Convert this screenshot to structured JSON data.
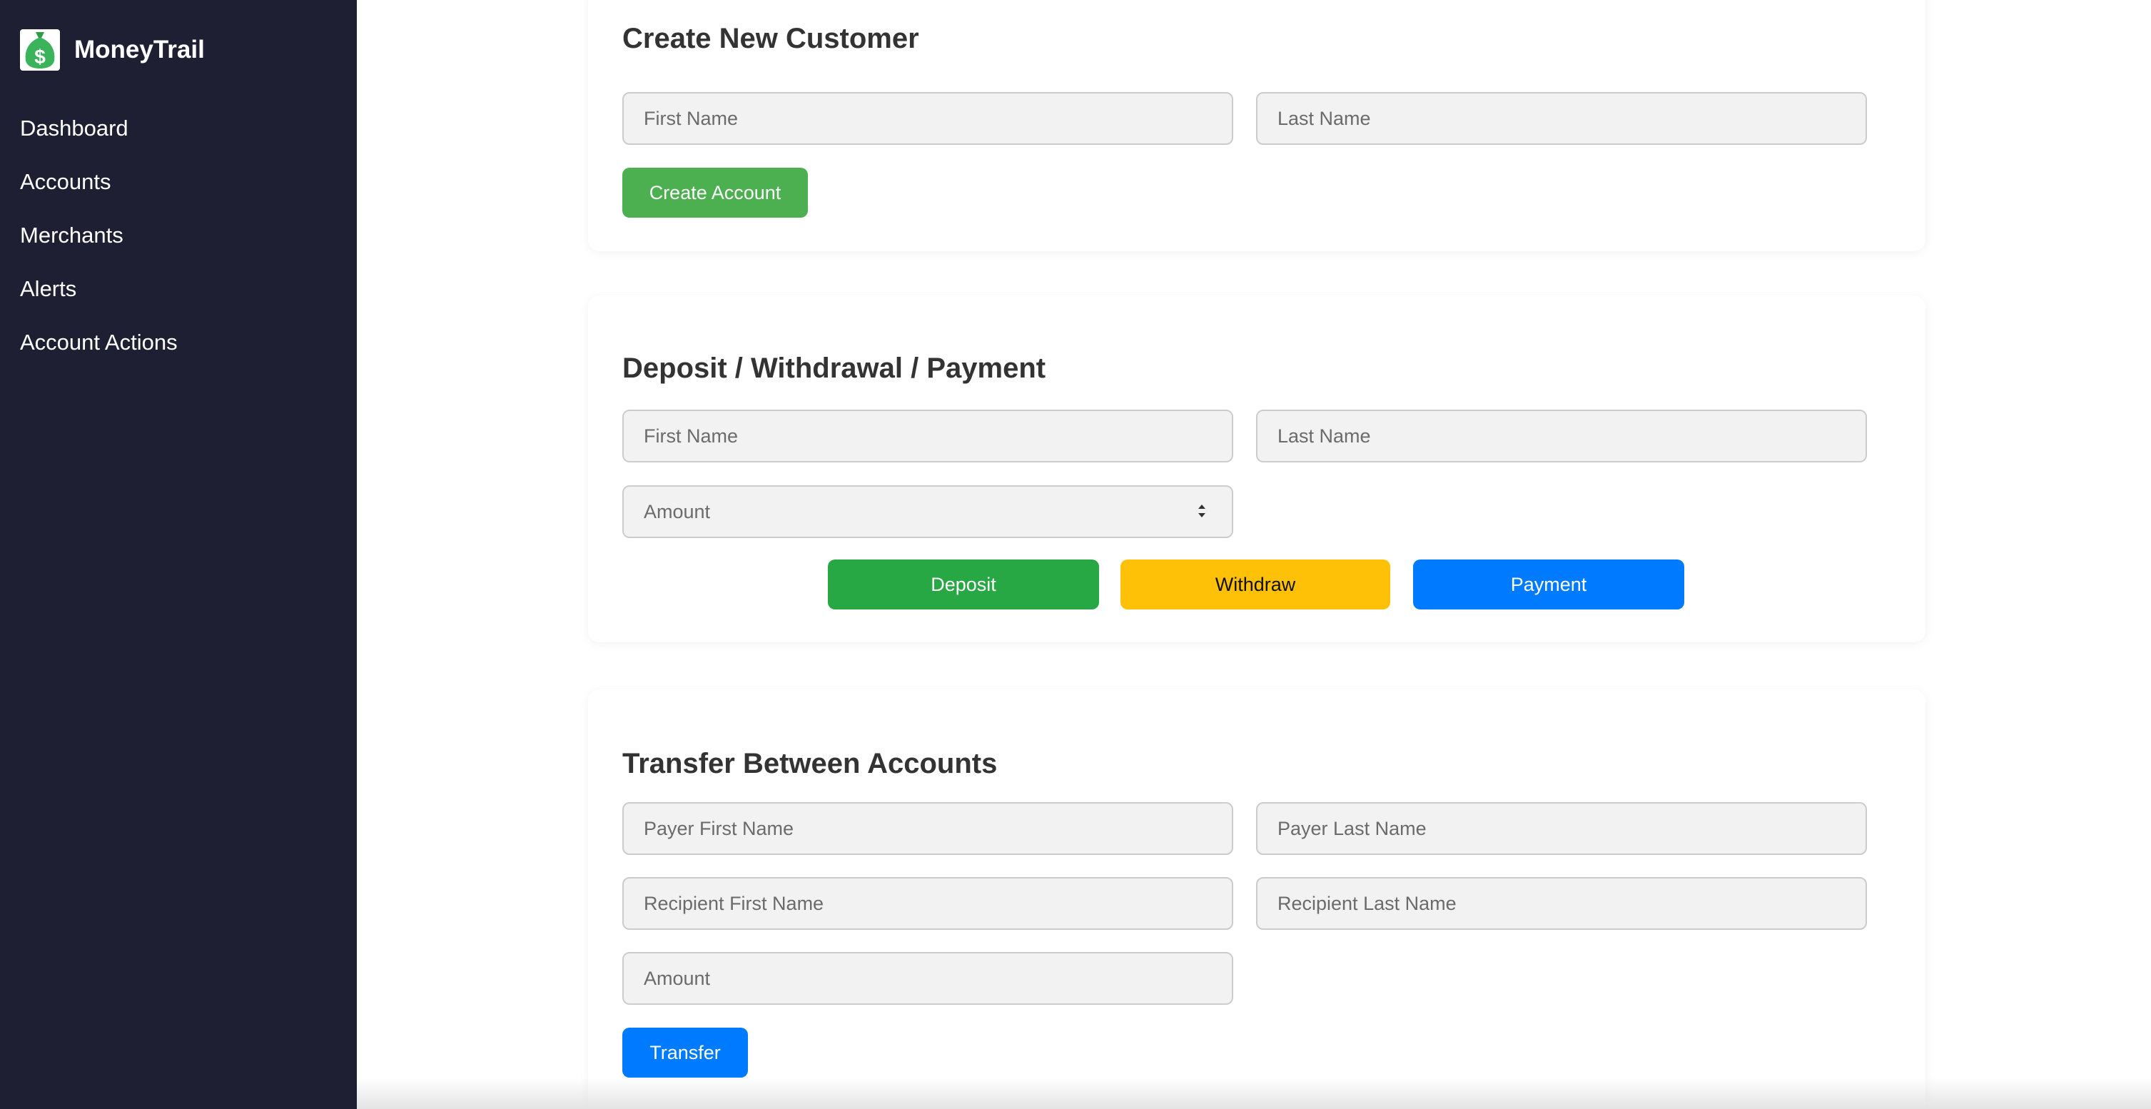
{
  "app": {
    "name": "MoneyTrail"
  },
  "sidebar": {
    "items": [
      {
        "label": "Dashboard"
      },
      {
        "label": "Accounts"
      },
      {
        "label": "Merchants"
      },
      {
        "label": "Alerts"
      },
      {
        "label": "Account Actions"
      }
    ]
  },
  "create_customer": {
    "title": "Create New Customer",
    "first_name_placeholder": "First Name",
    "last_name_placeholder": "Last Name",
    "first_name_value": "",
    "last_name_value": "",
    "submit_label": "Create Account"
  },
  "transaction": {
    "title": "Deposit / Withdrawal / Payment",
    "first_name_placeholder": "First Name",
    "last_name_placeholder": "Last Name",
    "amount_placeholder": "Amount",
    "deposit_label": "Deposit",
    "withdraw_label": "Withdraw",
    "payment_label": "Payment"
  },
  "transfer": {
    "title": "Transfer Between Accounts",
    "payer_first_placeholder": "Payer First Name",
    "payer_last_placeholder": "Payer Last Name",
    "recipient_first_placeholder": "Recipient First Name",
    "recipient_last_placeholder": "Recipient Last Name",
    "amount_placeholder": "Amount",
    "submit_label": "Transfer"
  },
  "colors": {
    "sidebar_bg": "#1f1f33",
    "create_green": "#4caf50",
    "deposit_green": "#28a745",
    "withdraw_yellow": "#ffc107",
    "primary_blue": "#007bff"
  },
  "icons": {
    "logo": "money-bag-dollar-icon",
    "amount_stepper": "stepper-arrows-icon"
  }
}
